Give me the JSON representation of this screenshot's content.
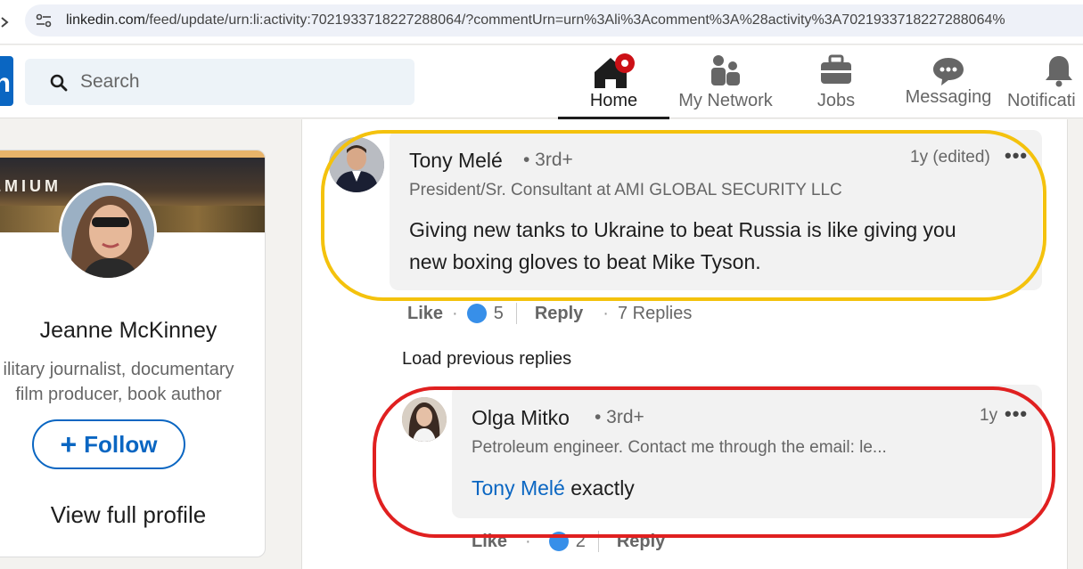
{
  "browser": {
    "url_host": "linkedin.com",
    "url_path": "/feed/update/urn:li:activity:7021933718227288064/?commentUrn=urn%3Ali%3Acomment%3A%28activity%3A7021933718227288064%"
  },
  "nav": {
    "search_placeholder": "Search",
    "items": [
      {
        "label": "Home",
        "icon": "home-icon",
        "active": true
      },
      {
        "label": "My Network",
        "icon": "network-icon",
        "active": false
      },
      {
        "label": "Jobs",
        "icon": "briefcase-icon",
        "active": false
      },
      {
        "label": "Messaging",
        "icon": "messaging-icon",
        "active": false
      },
      {
        "label": "Notificati",
        "icon": "bell-icon",
        "active": false
      }
    ],
    "notification_color": "#cc1016"
  },
  "profile": {
    "badge": "EMIUM",
    "name": "Jeanne McKinney",
    "headline_line1": "ilitary journalist, documentary",
    "headline_line2": "film producer, book author",
    "follow_label": "Follow",
    "view_profile_label": "View full profile"
  },
  "comments": [
    {
      "author": "Tony Melé",
      "degree": "• 3rd+",
      "time": "1y (edited)",
      "subtitle": "President/Sr. Consultant at AMI GLOBAL SECURITY LLC",
      "text_line1": "Giving new tanks to Ukraine to beat Russia is like giving you",
      "text_line2": "new boxing gloves to beat Mike Tyson.",
      "like_label": "Like",
      "like_count": "5",
      "reply_label": "Reply",
      "replies_label": "7 Replies",
      "highlight_color": "#f4c20d"
    },
    {
      "author": "Olga Mitko",
      "degree": "• 3rd+",
      "time": "1y",
      "subtitle": "Petroleum engineer. Contact me through the email: le...",
      "mention": "Tony Melé",
      "text": "exactly",
      "like_label": "Like",
      "like_count": "2",
      "reply_label": "Reply",
      "highlight_color": "#e02020"
    }
  ],
  "load_previous": "Load previous replies",
  "more_glyph": "•••"
}
